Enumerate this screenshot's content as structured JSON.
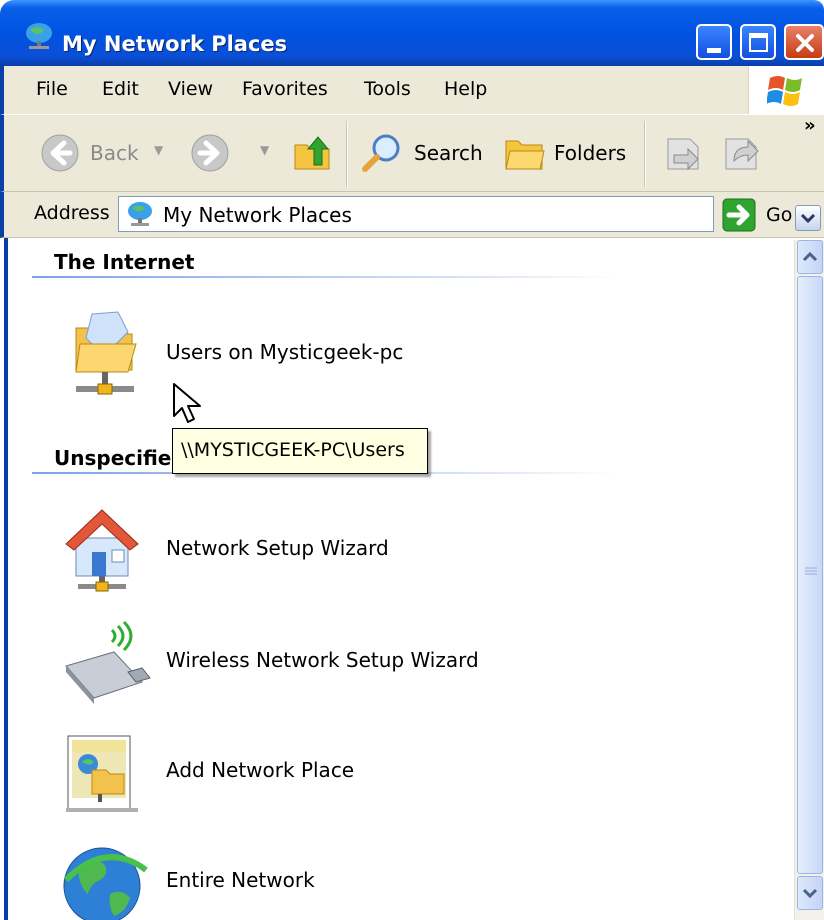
{
  "window": {
    "title": "My Network Places"
  },
  "menu": [
    "File",
    "Edit",
    "View",
    "Favorites",
    "Tools",
    "Help"
  ],
  "toolbar": {
    "back_label": "Back",
    "search_label": "Search",
    "folders_label": "Folders",
    "overflow": "»"
  },
  "address": {
    "label": "Address",
    "value": "My Network Places",
    "go_label": "Go"
  },
  "groups": [
    {
      "title": "The Internet",
      "items": [
        {
          "label": "Users on Mysticgeek-pc",
          "icon": "network-share-folder-icon"
        }
      ]
    },
    {
      "title": "Unspecified",
      "items": [
        {
          "label": "Network Setup Wizard",
          "icon": "network-house-icon"
        },
        {
          "label": "Wireless Network Setup Wizard",
          "icon": "usb-wireless-icon"
        },
        {
          "label": "Add Network Place",
          "icon": "add-network-place-icon"
        },
        {
          "label": "Entire Network",
          "icon": "globe-icon"
        }
      ]
    }
  ],
  "tooltip": "\\\\MYSTICGEEK-PC\\Users",
  "colors": {
    "titlebar": "#0053e1",
    "chrome": "#ece9d8",
    "tooltip_bg": "#ffffe1",
    "close_button": "#c53c14"
  }
}
